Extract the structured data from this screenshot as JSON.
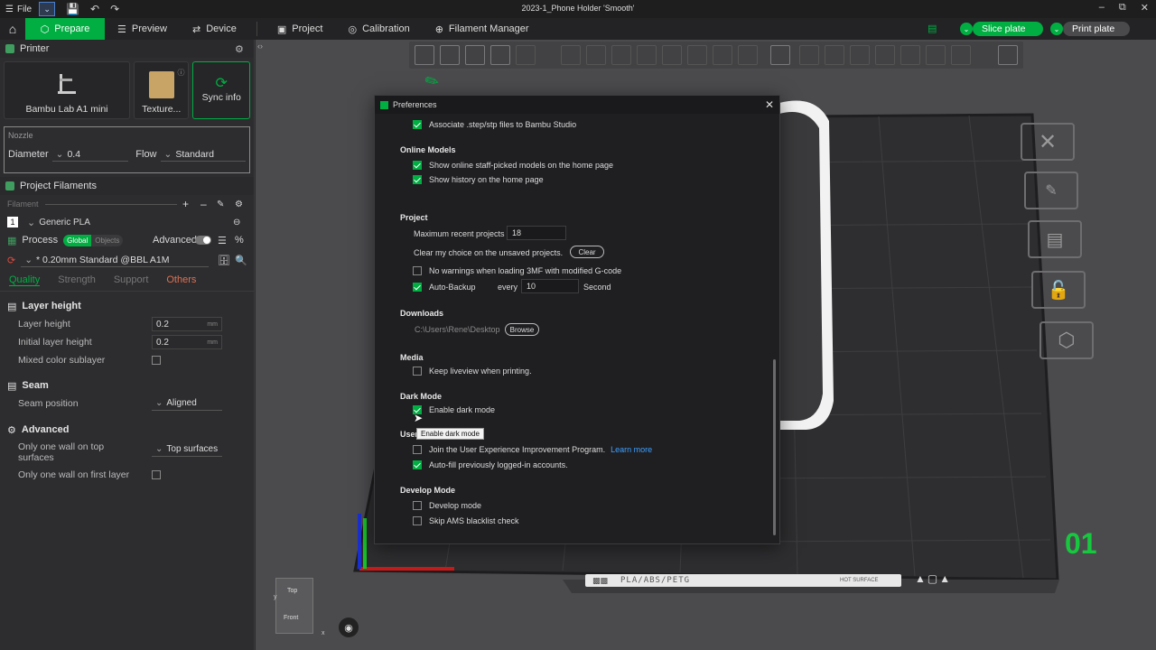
{
  "titlebar": {
    "file_label": "File",
    "title": "2023-1_Phone Holder 'Smooth'"
  },
  "topbar": {
    "tabs": [
      {
        "label": "Prepare",
        "icon": "cube-icon"
      },
      {
        "label": "Preview",
        "icon": "layers-icon"
      },
      {
        "label": "Device",
        "icon": "sync-icon"
      },
      {
        "label": "Project",
        "icon": "doc-icon"
      },
      {
        "label": "Calibration",
        "icon": "target-icon"
      },
      {
        "label": "Filament Manager",
        "icon": "spool-icon"
      }
    ],
    "slice_label": "Slice plate",
    "print_label": "Print plate"
  },
  "left": {
    "printer_header": "Printer",
    "printer_name": "Bambu Lab A1 mini",
    "texture_label": "Texture...",
    "sync_label": "Sync info",
    "nozzle_label": "Nozzle",
    "diameter_label": "Diameter",
    "diameter_value": "0.4",
    "flow_label": "Flow",
    "flow_value": "Standard",
    "project_filaments": "Project Filaments",
    "filament_label": "Filament",
    "filament_index": "1",
    "filament_name": "Generic PLA",
    "process_label": "Process",
    "global_label": "Global",
    "objects_label": "Objects",
    "advanced_label": "Advanced",
    "process_preset": "* 0.20mm Standard @BBL A1M",
    "tabs": [
      "Quality",
      "Strength",
      "Support",
      "Others"
    ],
    "layer_height_group": "Layer height",
    "layer_height_label": "Layer height",
    "layer_height_value": "0.2",
    "initial_layer_label": "Initial layer height",
    "initial_layer_value": "0.2",
    "unit_mm": "mm",
    "mixed_color_label": "Mixed color sublayer",
    "seam_group": "Seam",
    "seam_position_label": "Seam position",
    "seam_position_value": "Aligned",
    "advanced_group": "Advanced",
    "one_wall_top_label": "Only one wall on top surfaces",
    "one_wall_top_value": "Top surfaces",
    "one_wall_first_label": "Only one wall on first layer"
  },
  "viewport": {
    "plate_number": "01",
    "plate_label": "PLA/ABS/PETG",
    "hot_surface": "HOT SURFACE",
    "view_top": "Top",
    "view_front": "Front"
  },
  "dialog": {
    "title": "Preferences",
    "associate_step": "Associate .step/stp files to Bambu Studio",
    "online_models": "Online Models",
    "show_staff_picked": "Show online staff-picked models on the home page",
    "show_history": "Show history on the home page",
    "project_head": "Project",
    "max_recent": "Maximum recent projects",
    "max_recent_value": "18",
    "clear_choice": "Clear my choice on the unsaved projects.",
    "clear_btn": "Clear",
    "no_warnings": "No warnings when loading 3MF with modified G-code",
    "auto_backup": "Auto-Backup",
    "every": "every",
    "every_value": "10",
    "second": "Second",
    "downloads_head": "Downloads",
    "download_path": "C:\\Users\\Rene\\Desktop",
    "browse_btn": "Browse",
    "media_head": "Media",
    "keep_liveview": "Keep liveview when printing.",
    "dark_mode_head": "Dark Mode",
    "enable_dark": "Enable dark mode",
    "tooltip": "Enable dark mode",
    "user_head": "User",
    "join_program": "Join the User Experience Improvement Program.",
    "learn_more": "Learn more",
    "autofill": "Auto-fill previously logged-in accounts.",
    "develop_head": "Develop Mode",
    "develop_mode": "Develop mode",
    "skip_ams": "Skip AMS blacklist check"
  },
  "colors": {
    "accent": "#00ae42",
    "link": "#3da0ff"
  }
}
